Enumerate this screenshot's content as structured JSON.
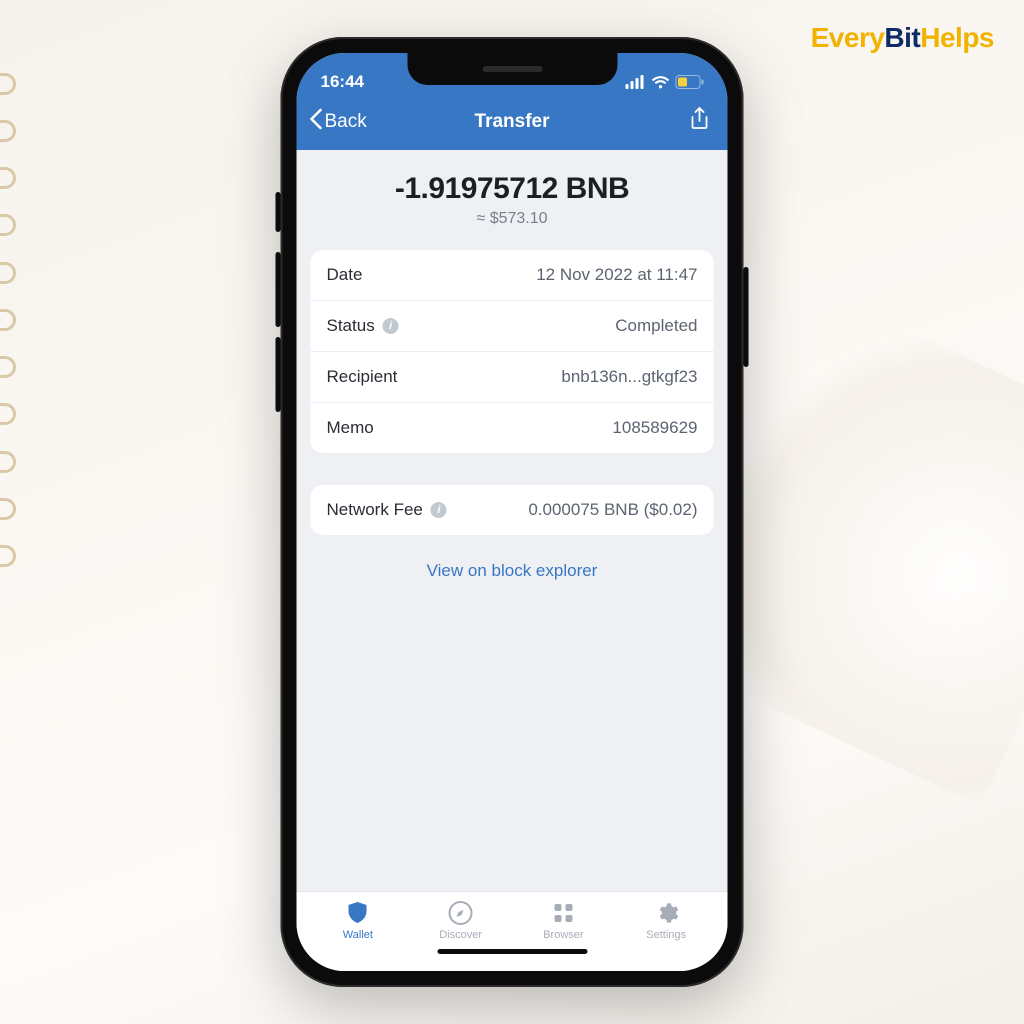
{
  "brand": {
    "part1": "Every",
    "part2": "Bit",
    "part3": "Helps"
  },
  "status": {
    "time": "16:44"
  },
  "header": {
    "back": "Back",
    "title": "Transfer"
  },
  "amount": {
    "main": "-1.91975712 BNB",
    "fiat": "≈ $573.10"
  },
  "details": {
    "date_label": "Date",
    "date_value": "12 Nov 2022 at 11:47",
    "status_label": "Status",
    "status_value": "Completed",
    "recipient_label": "Recipient",
    "recipient_value": "bnb136n...gtkgf23",
    "memo_label": "Memo",
    "memo_value": "108589629"
  },
  "fee": {
    "label": "Network Fee",
    "value": "0.000075 BNB ($0.02)"
  },
  "explorer_link": "View on block explorer",
  "tabs": {
    "wallet": "Wallet",
    "discover": "Discover",
    "browser": "Browser",
    "settings": "Settings"
  }
}
